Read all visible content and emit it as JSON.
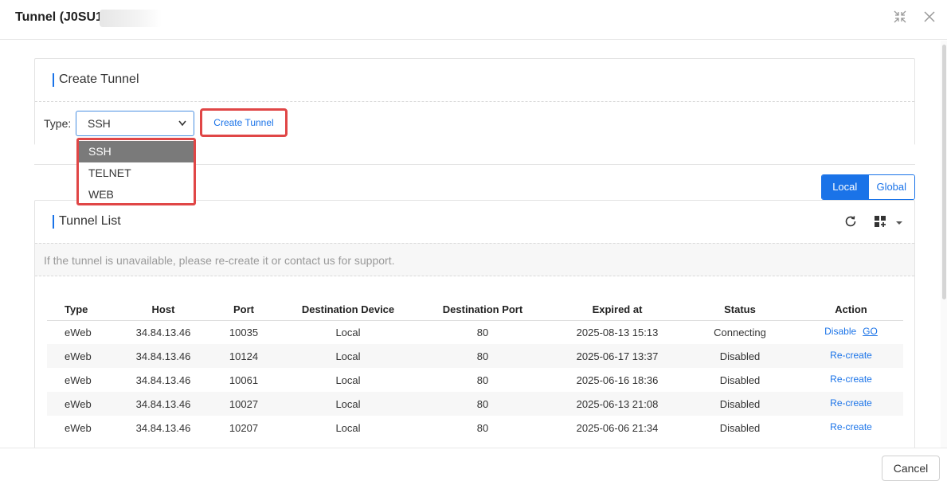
{
  "modal": {
    "title": "Tunnel (J0SU1L6",
    "expand_icon": "collapse-arrows-icon",
    "close_icon": "close-icon"
  },
  "create_section": {
    "title": "Create Tunnel",
    "type_label": "Type:",
    "type_selected": "SSH",
    "type_options": [
      "SSH",
      "TELNET",
      "WEB"
    ],
    "create_button": "Create Tunnel"
  },
  "scope_toggle": {
    "options": [
      "Local",
      "Global"
    ],
    "active": "Local"
  },
  "list_section": {
    "title": "Tunnel List",
    "refresh_icon": "refresh-icon",
    "columns_icon": "column-settings-icon",
    "notice": "If the tunnel is unavailable, please re-create it or contact us for support.",
    "columns": [
      "Type",
      "Host",
      "Port",
      "Destination Device",
      "Destination Port",
      "Expired at",
      "Status",
      "Action"
    ],
    "rows": [
      {
        "type": "eWeb",
        "host": "34.84.13.46",
        "port": "10035",
        "dest_device": "Local",
        "dest_port": "80",
        "expired": "2025-08-13 15:13",
        "status": "Connecting",
        "actions": [
          "Disable",
          "GO"
        ]
      },
      {
        "type": "eWeb",
        "host": "34.84.13.46",
        "port": "10124",
        "dest_device": "Local",
        "dest_port": "80",
        "expired": "2025-06-17 13:37",
        "status": "Disabled",
        "actions": [
          "Re-create"
        ]
      },
      {
        "type": "eWeb",
        "host": "34.84.13.46",
        "port": "10061",
        "dest_device": "Local",
        "dest_port": "80",
        "expired": "2025-06-16 18:36",
        "status": "Disabled",
        "actions": [
          "Re-create"
        ]
      },
      {
        "type": "eWeb",
        "host": "34.84.13.46",
        "port": "10027",
        "dest_device": "Local",
        "dest_port": "80",
        "expired": "2025-06-13 21:08",
        "status": "Disabled",
        "actions": [
          "Re-create"
        ]
      },
      {
        "type": "eWeb",
        "host": "34.84.13.46",
        "port": "10207",
        "dest_device": "Local",
        "dest_port": "80",
        "expired": "2025-06-06 21:34",
        "status": "Disabled",
        "actions": [
          "Re-create"
        ]
      }
    ]
  },
  "footer": {
    "cancel_button": "Cancel"
  },
  "colors": {
    "accent": "#1a73e8",
    "highlight_border": "#e04646",
    "selected_option": "#7a7a7a"
  }
}
